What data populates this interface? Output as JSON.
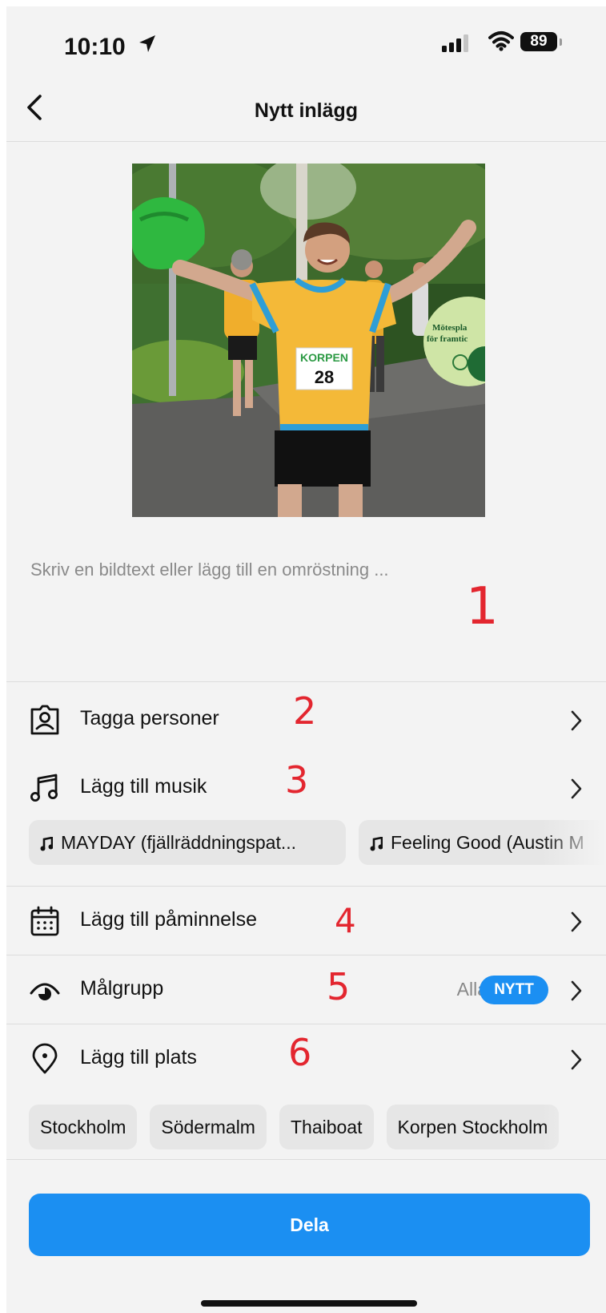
{
  "status_bar": {
    "time": "10:10",
    "battery": "89"
  },
  "nav": {
    "title": "Nytt inlägg"
  },
  "caption": {
    "placeholder": "Skriv en bildtext eller lägg till en omröstning ..."
  },
  "photo": {
    "bib_label": "KORPEN",
    "bib_number": "28",
    "sign_line1": "Mötespla",
    "sign_line2": "för framtic"
  },
  "annotations": [
    "1",
    "2",
    "3",
    "4",
    "5",
    "6"
  ],
  "rows": {
    "tag_people": "Tagga personer",
    "music": "Lägg till musik",
    "reminder": "Lägg till påminnelse",
    "audience": "Målgrupp",
    "audience_value": "Alla",
    "audience_badge": "NYTT",
    "location": "Lägg till plats"
  },
  "music_suggestions": [
    "MAYDAY (fjällräddningspat...",
    "Feeling Good (Austin M"
  ],
  "location_suggestions": [
    "Stockholm",
    "Södermalm",
    "Thaiboat",
    "Korpen Stockholm"
  ],
  "share_button": "Dela",
  "colors": {
    "accent": "#1b8ff2",
    "annotation": "#e3262f",
    "background": "#f3f3f3"
  }
}
